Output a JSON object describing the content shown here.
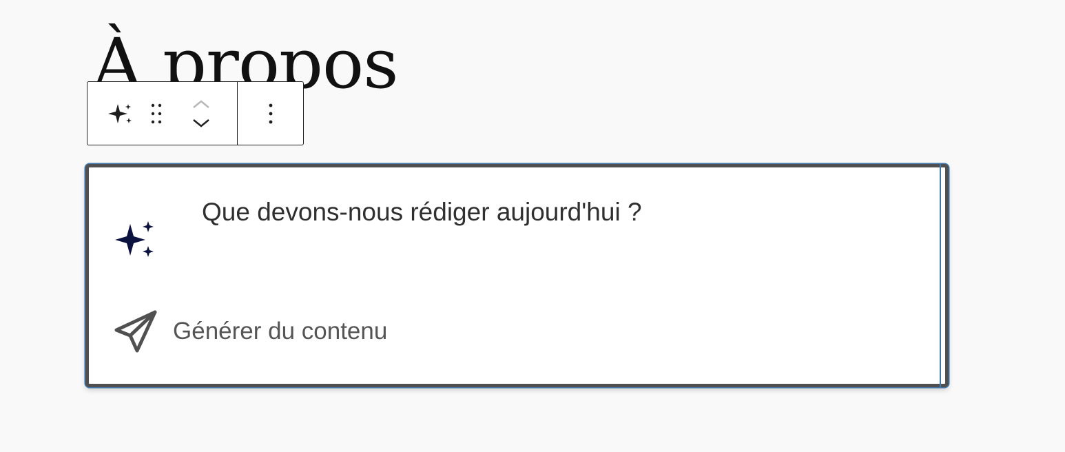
{
  "page": {
    "title": "À propos"
  },
  "toolbar": {
    "icons": {
      "block_type": "sparkles-icon",
      "drag": "drag-handle-icon",
      "move_up": "chevron-up-icon",
      "move_down": "chevron-down-icon",
      "options": "more-vertical-icon"
    }
  },
  "ai_block": {
    "icon": "sparkles-icon",
    "prompt_placeholder": "Que devons-nous rédiger aujourd'hui ?",
    "prompt_value": "",
    "generate_icon": "send-icon",
    "generate_label": "Générer du contenu"
  },
  "colors": {
    "focus_blue": "#3f78ad",
    "block_border": "#505050",
    "sparkle_navy": "#0c1240",
    "toolbar_border": "#1e1e1e",
    "disabled_gray": "#b8b8b8"
  }
}
